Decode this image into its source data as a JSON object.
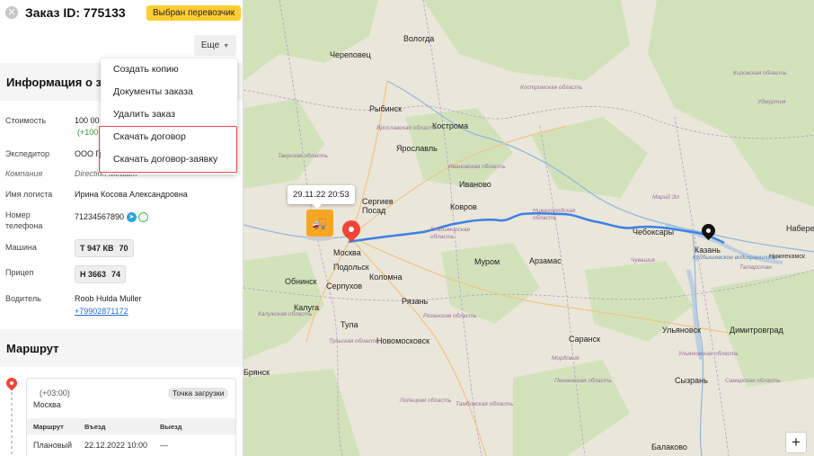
{
  "header": {
    "close_icon": "close-icon",
    "title": "Заказ ID: 775133",
    "status_badge": "Выбран перевозчик",
    "status_color": "#ffcc33",
    "more_button": "Еще"
  },
  "menu": {
    "items": [
      "Создать копию",
      "Документы заказа",
      "Удалить заказ",
      "Скачать договор",
      "Скачать договор-заявку"
    ],
    "highlight_color": "#e34a4a"
  },
  "info": {
    "title": "Информация о з",
    "rows": {
      "cost_label": "Стоимость",
      "cost_value": "100 00",
      "cost_extra": "(+100",
      "forwarder_label": "Экспедитор",
      "forwarder_value": "ООО Гр",
      "company_label": "Компания",
      "company_value": "Direction Medium",
      "logist_label": "Имя логиста",
      "logist_value": "Ирина Косова Александровна",
      "phone_label": "Номер телефона",
      "phone_value": "71234567890",
      "car_label": "Машина",
      "car_number": "Т 947 КВ",
      "car_region": "70",
      "trailer_label": "Прицеп",
      "trailer_number": "Н 3663",
      "trailer_region": "74",
      "driver_label": "Водитель",
      "driver_name": "Roob Hulda Muller",
      "driver_phone": "+79902871172"
    }
  },
  "route": {
    "title": "Маршрут",
    "tz": "(+03:00)",
    "city": "Москва",
    "badge": "Точка загрузки",
    "columns": [
      "Маршрут",
      "Въезд",
      "Выезд"
    ],
    "row": [
      "Плановый",
      "22.12.2022 10:00",
      "—"
    ]
  },
  "map": {
    "tooltip": "29.11.22 20:53",
    "route_color": "#3b82e6",
    "zoom_in": "+",
    "labels": [
      {
        "text": "Вологда",
        "kind": "big"
      },
      {
        "text": "Череповец",
        "kind": "big"
      },
      {
        "text": "Рыбинск",
        "kind": "big"
      },
      {
        "text": "Кострома",
        "kind": "big"
      },
      {
        "text": "Ярославль",
        "kind": "big"
      },
      {
        "text": "Иваново",
        "kind": "big"
      },
      {
        "text": "Ковров",
        "kind": "big"
      },
      {
        "text": "Сергиев Посад",
        "kind": "big"
      },
      {
        "text": "Москва",
        "kind": "big"
      },
      {
        "text": "Подольск",
        "kind": "big"
      },
      {
        "text": "Коломна",
        "kind": "big"
      },
      {
        "text": "Обнинск",
        "kind": "big"
      },
      {
        "text": "Серпухов",
        "kind": "big"
      },
      {
        "text": "Калуга",
        "kind": "big"
      },
      {
        "text": "Рязань",
        "kind": "big"
      },
      {
        "text": "Тула",
        "kind": "big"
      },
      {
        "text": "Новомосковск",
        "kind": "big"
      },
      {
        "text": "Муром",
        "kind": "big"
      },
      {
        "text": "Арзамас",
        "kind": "big"
      },
      {
        "text": "Чебоксары",
        "kind": "big"
      },
      {
        "text": "Казань",
        "kind": "big"
      },
      {
        "text": "Набере",
        "kind": "big"
      },
      {
        "text": "Нижнекамск",
        "kind": "big"
      },
      {
        "text": "Марий Эл",
        "kind": "reg"
      },
      {
        "text": "Саранск",
        "kind": "big"
      },
      {
        "text": "Ульяновск",
        "kind": "big"
      },
      {
        "text": "Димитровград",
        "kind": "big"
      },
      {
        "text": "Сызрань",
        "kind": "big"
      },
      {
        "text": "Балаково",
        "kind": "big"
      },
      {
        "text": "Брянск",
        "kind": "big"
      },
      {
        "text": "Кировская область",
        "kind": "reg"
      },
      {
        "text": "Костромская область",
        "kind": "reg"
      },
      {
        "text": "Ярославская область",
        "kind": "reg"
      },
      {
        "text": "Тверская область",
        "kind": "reg"
      },
      {
        "text": "Ивановская область",
        "kind": "reg"
      },
      {
        "text": "Владимирская область",
        "kind": "reg"
      },
      {
        "text": "Нижегородская область",
        "kind": "reg"
      },
      {
        "text": "Чувашия",
        "kind": "reg"
      },
      {
        "text": "Татарстан",
        "kind": "reg"
      },
      {
        "text": "Калужская область",
        "kind": "reg"
      },
      {
        "text": "Рязанская область",
        "kind": "reg"
      },
      {
        "text": "Тульская область",
        "kind": "reg"
      },
      {
        "text": "Мордовия",
        "kind": "reg"
      },
      {
        "text": "Пензенская область",
        "kind": "reg"
      },
      {
        "text": "Ульяновская область",
        "kind": "reg"
      },
      {
        "text": "Липецкая область",
        "kind": "reg"
      },
      {
        "text": "Тамбовская область",
        "kind": "reg"
      },
      {
        "text": "Самарская область",
        "kind": "reg"
      },
      {
        "text": "Удмуртия",
        "kind": "reg"
      },
      {
        "text": "Куйбышевское водохранилище",
        "kind": "water"
      }
    ]
  }
}
